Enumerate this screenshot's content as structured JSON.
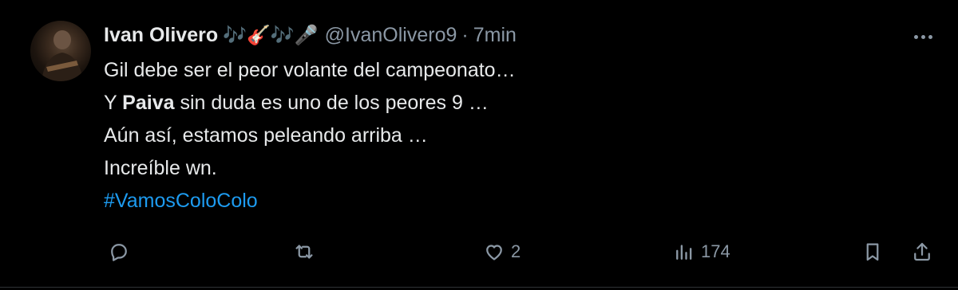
{
  "author": {
    "display_name": "Ivan Olivero",
    "emojis": [
      "🎶",
      "🎸",
      "🎶🎤"
    ],
    "handle": "@IvanOlivero9",
    "separator": "·",
    "time": "7min"
  },
  "tweet": {
    "line1": "Gil debe ser el peor volante del campeonato…",
    "line2_prefix": "Y ",
    "line2_bold": "Paiva",
    "line2_suffix": " sin duda es uno de los peores 9 …",
    "line3": "Aún así, estamos peleando arriba …",
    "line4": "Increíble wn.",
    "hashtag": "#VamosColoColo"
  },
  "actions": {
    "reply_count": "",
    "retweet_count": "",
    "like_count": "2",
    "views_count": "174"
  },
  "icons": {
    "avatar": "profile-photo",
    "more": "more-dots-icon",
    "reply": "reply-icon",
    "retweet": "retweet-icon",
    "like": "heart-icon",
    "views": "views-icon",
    "bookmark": "bookmark-icon",
    "share": "share-icon"
  },
  "colors": {
    "background": "#000000",
    "text": "#e7e9ea",
    "secondary": "#8b98a5",
    "link": "#1d9bf0"
  }
}
